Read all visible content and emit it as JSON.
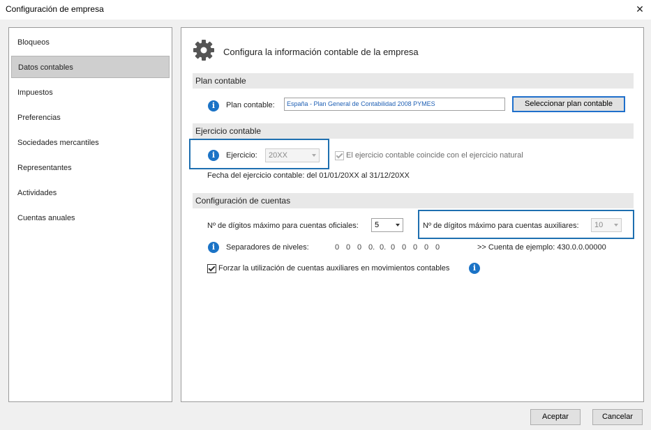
{
  "window": {
    "title": "Configuración de empresa",
    "close_glyph": "✕"
  },
  "sidebar": {
    "items": [
      {
        "label": "Bloqueos"
      },
      {
        "label": "Datos contables"
      },
      {
        "label": "Impuestos"
      },
      {
        "label": "Preferencias"
      },
      {
        "label": "Sociedades mercantiles"
      },
      {
        "label": "Representantes"
      },
      {
        "label": "Actividades"
      },
      {
        "label": "Cuentas anuales"
      }
    ],
    "active_index": 1
  },
  "main": {
    "heading": "Configura la información contable de la empresa",
    "plan": {
      "section_title": "Plan contable",
      "label": "Plan contable:",
      "value": "España - Plan General de Contabilidad 2008 PYMES",
      "select_button": "Seleccionar plan contable"
    },
    "ejercicio": {
      "section_title": "Ejercicio contable",
      "label": "Ejercicio:",
      "value": "20XX",
      "natural_label": "El ejercicio contable coincide con el ejercicio natural",
      "natural_checked": true,
      "dates_text": "Fecha del ejercicio contable: del 01/01/20XX al 31/12/20XX"
    },
    "cuentas": {
      "section_title": "Configuración de cuentas",
      "oficiales_label": "Nº de dígitos máximo para cuentas oficiales:",
      "oficiales_value": "5",
      "auxiliares_label": "Nº de dígitos máximo para cuentas auxiliares:",
      "auxiliares_value": "10",
      "separadores_label": "Separadores de niveles:",
      "separadores_digits": [
        "0",
        "0",
        "0",
        "0.",
        "0.",
        "0",
        "0",
        "0",
        "0",
        "0"
      ],
      "ejemplo": ">> Cuenta de ejemplo: 430.0.0.00000",
      "forzar_label": "Forzar la utilización de cuentas auxiliares en movimientos contables",
      "forzar_checked": true
    }
  },
  "footer": {
    "accept": "Aceptar",
    "cancel": "Cancelar"
  },
  "colors": {
    "accent": "#1e6fb0",
    "info": "#1b73c6",
    "active_nav": "#cfcfcf"
  },
  "icons": [
    "close-icon",
    "gear-icon",
    "info-icon",
    "chevron-down-icon",
    "checkmark-icon"
  ]
}
